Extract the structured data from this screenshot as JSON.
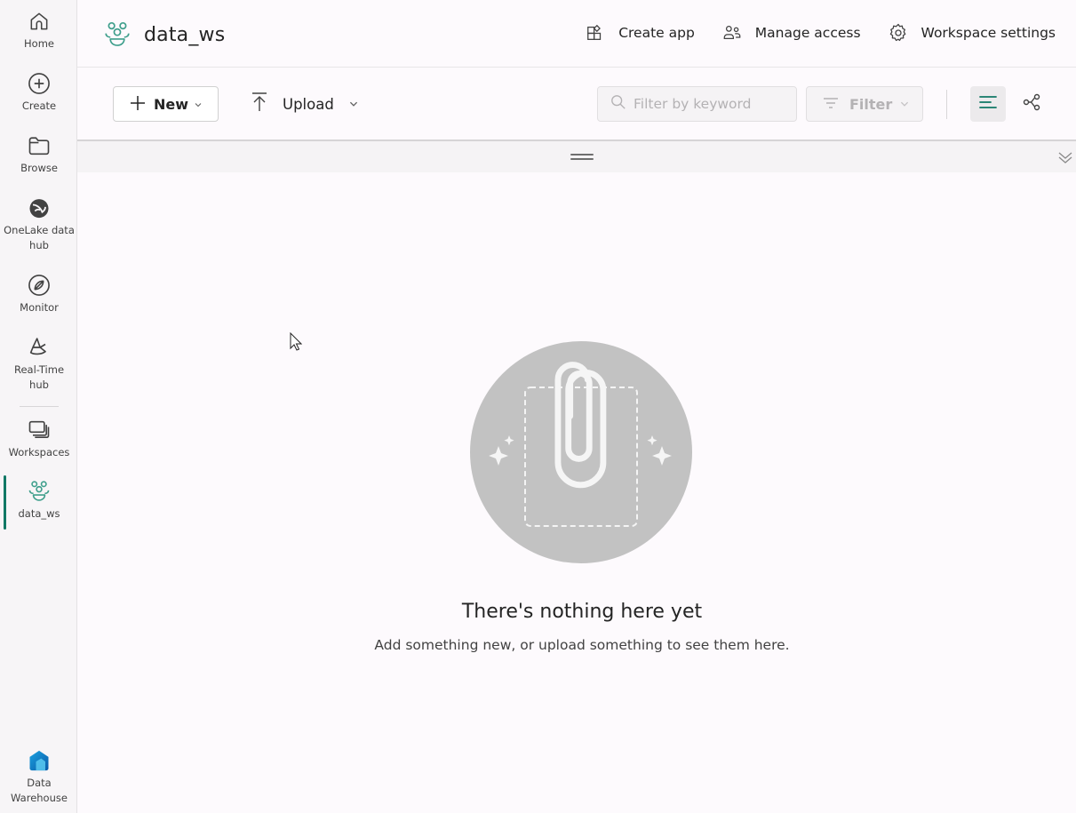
{
  "rail": {
    "items": [
      {
        "label": "Home",
        "icon": "home-icon"
      },
      {
        "label": "Create",
        "icon": "plus-circle-icon"
      },
      {
        "label": "Browse",
        "icon": "folder-icon"
      },
      {
        "label": "OneLake data hub",
        "icon": "onelake-icon"
      },
      {
        "label": "Monitor",
        "icon": "monitor-icon"
      },
      {
        "label": "Real-Time hub",
        "icon": "realtime-hub-icon"
      },
      {
        "label": "Workspaces",
        "icon": "workspaces-icon"
      },
      {
        "label": "data_ws",
        "icon": "workspace-people-icon",
        "active": true
      }
    ],
    "footer": {
      "label": "Data Warehouse",
      "icon": "data-warehouse-icon"
    }
  },
  "header": {
    "workspace_name": "data_ws",
    "actions": {
      "create_app": "Create app",
      "manage_access": "Manage access",
      "workspace_settings": "Workspace settings"
    }
  },
  "toolbar": {
    "new_label": "New",
    "upload_label": "Upload",
    "search_placeholder": "Filter by keyword",
    "search_value": "",
    "filter_label": "Filter"
  },
  "empty_state": {
    "title": "There's nothing here yet",
    "subtitle": "Add something new, or upload something to see them here."
  },
  "colors": {
    "accent": "#117865",
    "workspace_icon": "#3f9f8c",
    "illustration_bg": "#c2c2c2"
  }
}
